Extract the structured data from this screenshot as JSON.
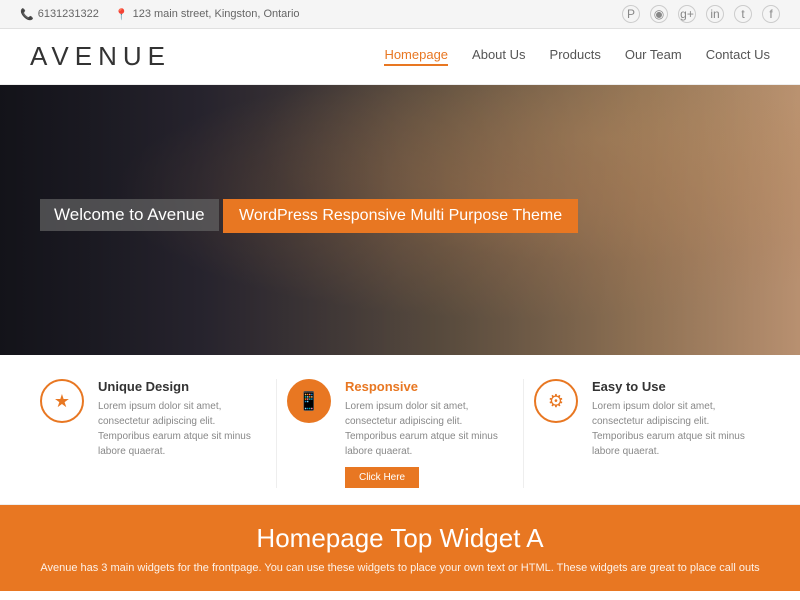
{
  "topbar": {
    "phone": "6131231322",
    "address": "123 main street, Kingston, Ontario",
    "socials": [
      "P",
      "◉",
      "g+",
      "in",
      "t",
      "f"
    ]
  },
  "header": {
    "logo": "AVENUE",
    "nav": [
      {
        "label": "Homepage",
        "active": true
      },
      {
        "label": "About Us",
        "active": false
      },
      {
        "label": "Products",
        "active": false
      },
      {
        "label": "Our Team",
        "active": false
      },
      {
        "label": "Contact Us",
        "active": false
      }
    ]
  },
  "hero": {
    "welcome": "Welcome to Avenue",
    "tagline": "WordPress Responsive Multi Purpose Theme"
  },
  "features": [
    {
      "icon": "★",
      "icon_style": "outline",
      "title": "Unique Design",
      "title_color": "dark",
      "description": "Lorem ipsum dolor sit amet, consectetur adipiscing elit. Temporibus earum atque sit minus labore quaerat."
    },
    {
      "icon": "📱",
      "icon_style": "filled",
      "title": "Responsive",
      "title_color": "orange",
      "description": "Lorem ipsum dolor sit amet, consectetur adipiscing elit. Temporibus earum atque sit minus labore quaerat.",
      "button": "Click Here"
    },
    {
      "icon": "⚙",
      "icon_style": "outline",
      "title": "Easy to Use",
      "title_color": "dark",
      "description": "Lorem ipsum dolor sit amet, consectetur adipiscing elit. Temporibus earum atque sit minus labore quaerat."
    }
  ],
  "widget": {
    "title": "Homepage Top Widget A",
    "description": "Avenue has 3 main widgets for the frontpage. You can use these widgets to place your own text or HTML. These widgets are great to place call outs"
  }
}
